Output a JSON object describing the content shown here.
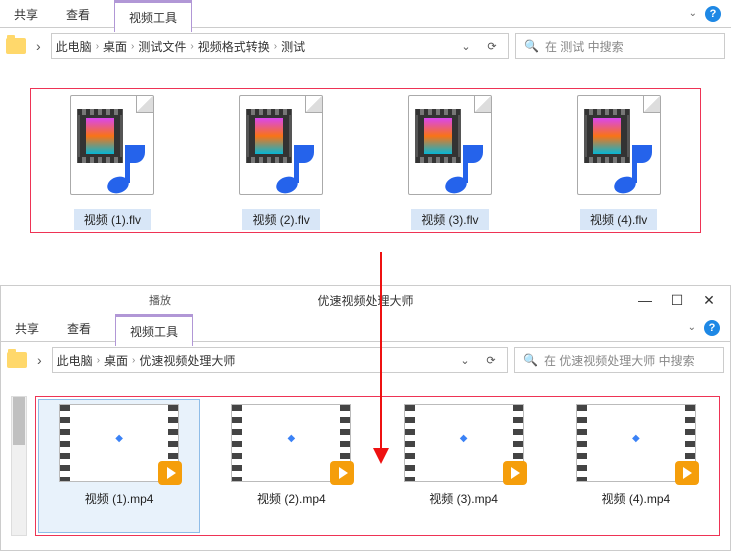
{
  "win1": {
    "tabs": {
      "share": "共享",
      "view": "查看",
      "videoTools": "视频工具"
    },
    "breadcrumb": [
      "此电脑",
      "桌面",
      "测试文件",
      "视频格式转换",
      "测试"
    ],
    "searchPlaceholder": "在 测试 中搜索",
    "files": [
      {
        "name": "视频 (1).flv"
      },
      {
        "name": "视频 (2).flv"
      },
      {
        "name": "视频 (3).flv"
      },
      {
        "name": "视频 (4).flv"
      }
    ]
  },
  "win2": {
    "play": "播放",
    "title": "优速视频处理大师",
    "tabs": {
      "share": "共享",
      "view": "查看",
      "videoTools": "视频工具"
    },
    "breadcrumb": [
      "此电脑",
      "桌面",
      "优速视频处理大师"
    ],
    "searchPlaceholder": "在 优速视频处理大师 中搜索",
    "files": [
      {
        "name": "视频 (1).mp4"
      },
      {
        "name": "视频 (2).mp4"
      },
      {
        "name": "视频 (3).mp4"
      },
      {
        "name": "视频 (4).mp4"
      }
    ]
  }
}
